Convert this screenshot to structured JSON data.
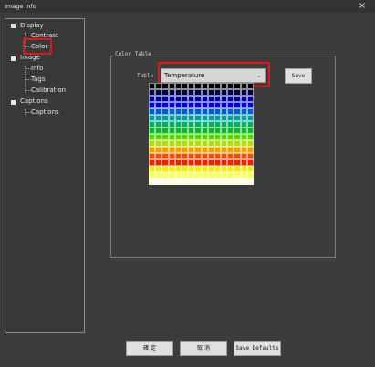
{
  "window": {
    "title": "Image Info",
    "close_glyph": "×"
  },
  "tree": {
    "display": "Display",
    "contrast": "Contrast",
    "color": "Color",
    "image": "Image",
    "info": "Info",
    "tags": "Tags",
    "calibration": "Calibration",
    "captions_group": "Captions",
    "captions": "Captions",
    "selected": "Color"
  },
  "color_table": {
    "group_label": "Color Table",
    "table_label": "Table",
    "selected_table": "Temperature",
    "save_label": "Save",
    "row_colors": [
      "#000000",
      "#000048",
      "#00009a",
      "#0000e6",
      "#0060c8",
      "#00a0a0",
      "#00b060",
      "#00c020",
      "#60d000",
      "#b0e000",
      "#f0a000",
      "#f05000",
      "#f02000",
      "#f0f000",
      "#ffff60",
      "#ffffe0"
    ]
  },
  "footer": {
    "ok_label": "確 定",
    "cancel_label": "取 消",
    "save_defaults_label": "Save Defaults"
  },
  "colors": {
    "highlight": "#e01818",
    "background": "#3c3c3c"
  }
}
